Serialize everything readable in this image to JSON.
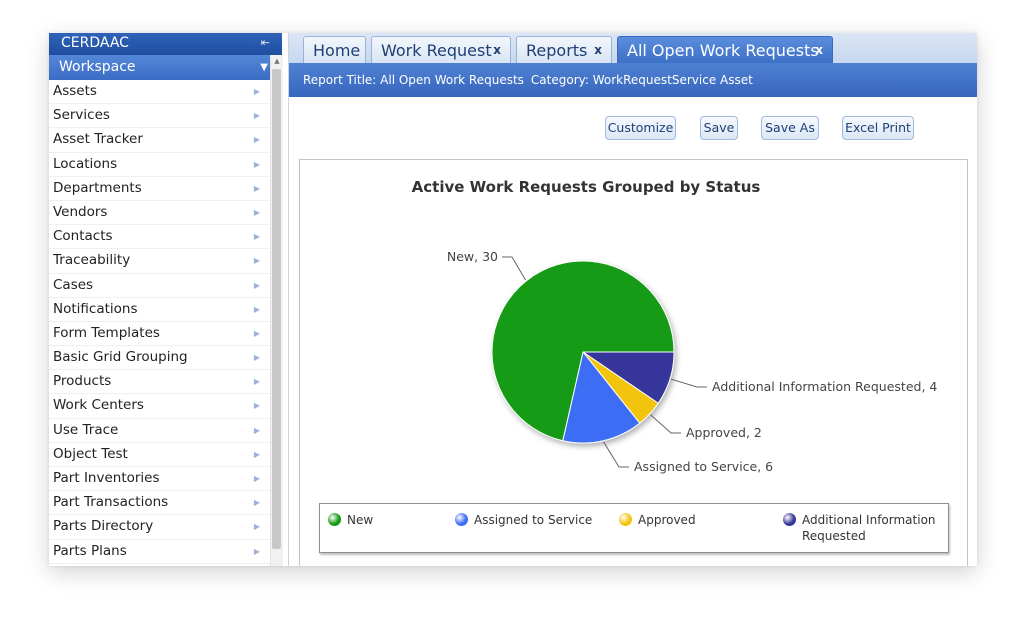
{
  "sidebar": {
    "brand": "CERDAAC",
    "collapse_icon": "collapse-left-icon",
    "workspace_label": "Workspace",
    "items": [
      {
        "label": "Assets"
      },
      {
        "label": "Services"
      },
      {
        "label": "Asset Tracker"
      },
      {
        "label": "Locations"
      },
      {
        "label": "Departments"
      },
      {
        "label": "Vendors"
      },
      {
        "label": "Contacts"
      },
      {
        "label": "Traceability"
      },
      {
        "label": "Cases"
      },
      {
        "label": "Notifications"
      },
      {
        "label": "Form Templates"
      },
      {
        "label": "Basic Grid Grouping"
      },
      {
        "label": "Products"
      },
      {
        "label": "Work Centers"
      },
      {
        "label": "Use Trace"
      },
      {
        "label": "Object Test"
      },
      {
        "label": "Part Inventories"
      },
      {
        "label": "Part Transactions"
      },
      {
        "label": "Parts Directory"
      },
      {
        "label": "Parts Plans"
      }
    ]
  },
  "tabs": [
    {
      "label": "Home",
      "closable": false
    },
    {
      "label": "Work Request",
      "closable": true,
      "close": "x"
    },
    {
      "label": "Reports",
      "closable": true,
      "close": "x"
    },
    {
      "label": "All Open Work Requests",
      "closable": true,
      "close": "x",
      "active": true
    }
  ],
  "report": {
    "title_text": "Report Title: All Open Work Requests",
    "category_text": "Category: WorkRequestService Asset"
  },
  "toolbar": {
    "customize_label": "Customize",
    "save_label": "Save",
    "save_as_label": "Save As",
    "excel_print_label": "Excel Print"
  },
  "colors": {
    "accent": "#3766bd",
    "new": "#139b13",
    "assigned": "#3d6cf5",
    "approved": "#f2c40a",
    "additional": "#35369a"
  },
  "chart_data": {
    "type": "pie",
    "title": "Active Work Requests Grouped by Status",
    "slices": [
      {
        "name": "New",
        "value": 30,
        "label": "New, 30",
        "color": "#139b13"
      },
      {
        "name": "Assigned to Service",
        "value": 6,
        "label": "Assigned to Service, 6",
        "color": "#3d6cf5"
      },
      {
        "name": "Approved",
        "value": 2,
        "label": "Approved, 2",
        "color": "#f2c40a"
      },
      {
        "name": "Additional Information Requested",
        "value": 4,
        "label": "Additional Information Requested, 4",
        "color": "#35369a"
      }
    ],
    "legend": {
      "placement": "bottom",
      "entries": [
        "New",
        "Assigned to Service",
        "Approved",
        "Additional Information Requested"
      ]
    }
  }
}
